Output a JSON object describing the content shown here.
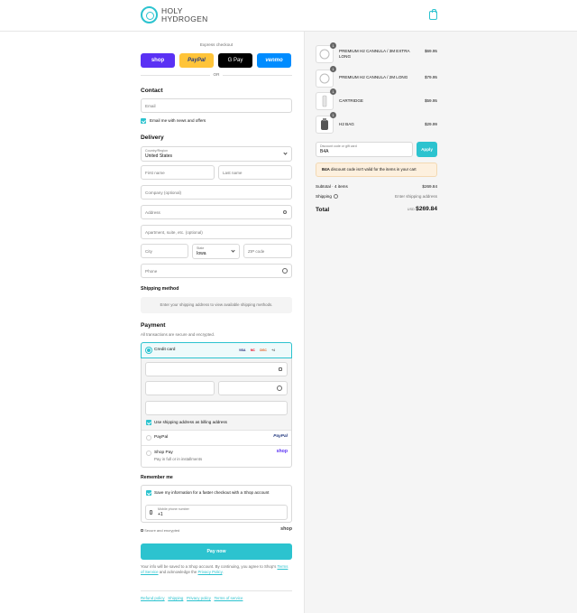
{
  "brand": {
    "line1": "HOLY",
    "line2": "HYDROGEN",
    "accent": "#2cc3cf"
  },
  "express": {
    "label": "Express checkout",
    "buttons": [
      {
        "label": "shop",
        "bg": "#5a31f4",
        "fg": "#ffffff"
      },
      {
        "label": "PayPal",
        "bg": "#ffc439",
        "fg": "#253b80"
      },
      {
        "label": "G Pay",
        "bg": "#000000",
        "fg": "#ffffff"
      },
      {
        "label": "venmo",
        "bg": "#008cff",
        "fg": "#ffffff"
      }
    ],
    "or": "OR"
  },
  "contact": {
    "heading": "Contact",
    "email_placeholder": "Email",
    "newsletter": "Email me with news and offers"
  },
  "delivery": {
    "heading": "Delivery",
    "country_label": "Country/Region",
    "country_value": "United States",
    "first_name": "First name",
    "last_name": "Last name",
    "company": "Company (optional)",
    "address": "Address",
    "apartment": "Apartment, suite, etc. (optional)",
    "city": "City",
    "state_label": "State",
    "state_value": "Iowa",
    "zip": "ZIP code",
    "phone": "Phone"
  },
  "shipping": {
    "heading": "Shipping method",
    "note": "Enter your shipping address to view available shipping methods."
  },
  "payment": {
    "heading": "Payment",
    "subtitle": "All transactions are secure and encrypted.",
    "credit_card": "Credit card",
    "card_brands": [
      "VISA",
      "MC",
      "DISC",
      "+4"
    ],
    "billing": "Use shipping address as billing address",
    "paypal": "PayPal",
    "paypal_logo": "PayPal",
    "shoppay": "Shop Pay",
    "shoppay_sub": "Pay in full or in installments",
    "shoppay_logo": "shop"
  },
  "remember": {
    "heading": "Remember me",
    "save_info": "Save my information for a faster checkout with a Shop account",
    "mobile_label": "Mobile phone number",
    "mobile_value": "+1",
    "secure": "Secure and encrypted",
    "shop_logo": "shop"
  },
  "pay_now": "Pay now",
  "legal": {
    "text1": "Your info will be saved to a Shop account. By continuing, you agree to Shop's",
    "tos": "Terms of Service",
    "text2": "and acknowledge the",
    "privacy": "Privacy Policy",
    "dot": "."
  },
  "footer_links": [
    "Refund policy",
    "Shipping",
    "Privacy policy",
    "Terms of service"
  ],
  "cart": {
    "items": [
      {
        "qty": "1",
        "name": "PREMIUM H2 CANNULA / 3M EXTRA LONG",
        "price": "$69.95"
      },
      {
        "qty": "1",
        "name": "PREMIUM H2 CANNULA / 2M LONG",
        "price": "$79.95"
      },
      {
        "qty": "1",
        "name": "CARTRIDGE",
        "price": "$59.95"
      },
      {
        "qty": "1",
        "name": "H2 BAG",
        "price": "$29.99"
      }
    ],
    "discount_label": "Discount code or gift card",
    "discount_value": "B4A",
    "apply": "Apply",
    "error_code": "B4A",
    "error_text": "discount code isn't valid for the items in your cart",
    "subtotal_label": "Subtotal · 4 items",
    "subtotal_value": "$269.84",
    "shipping_label": "Shipping",
    "shipping_value": "Enter shipping address",
    "total_label": "Total",
    "currency": "USD",
    "total_value": "$269.84"
  }
}
